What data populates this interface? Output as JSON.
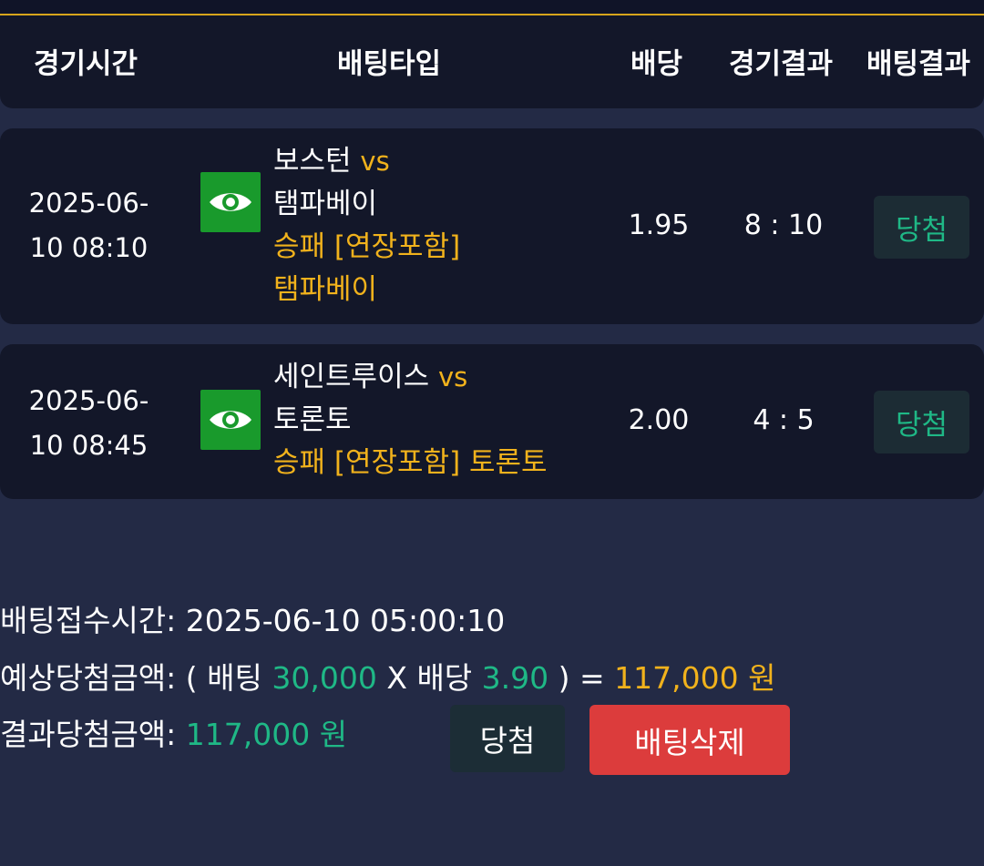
{
  "header": {
    "col_time": "경기시간",
    "col_bet_type": "배팅타입",
    "col_odds": "배당",
    "col_game_result": "경기결과",
    "col_bet_result": "배팅결과"
  },
  "rows": [
    {
      "time_line1": "2025-06-",
      "time_line2": "10 08:10",
      "eye_icon": "eye-icon",
      "home": "보스턴",
      "vs": "vs",
      "away": "탬파베이",
      "market": "승패 [연장포함]",
      "pick": "탬파베이",
      "odds": "1.95",
      "score": "8 : 10",
      "result": "당첨"
    },
    {
      "time_line1": "2025-06-",
      "time_line2": "10 08:45",
      "eye_icon": "eye-icon",
      "home": "세인트루이스",
      "vs": "vs",
      "away": "토론토",
      "market_pick": "승패 [연장포함] 토론토",
      "odds": "2.00",
      "score": "4 : 5",
      "result": "당첨"
    }
  ],
  "summary": {
    "bet_time_label": "배팅접수시간:",
    "bet_time_value": "2025-06-10 05:00:10",
    "expected_label": "예상당첨금액:",
    "expected_open": "( 배팅",
    "stake": "30,000",
    "times_odds": "X 배당",
    "total_odds": "3.90",
    "close_eq": ") =",
    "expected_amount": "117,000 원",
    "result_label": "결과당첨금액:",
    "result_amount": "117,000 원"
  },
  "buttons": {
    "win_label": "당첨",
    "delete_label": "배팅삭제"
  },
  "colors": {
    "background": "#232a45",
    "card": "#131729",
    "accent_gold": "#f1b21c",
    "win_teal": "#1fb886",
    "eye_green": "#199a2c",
    "delete_red": "#dc3c3c"
  }
}
